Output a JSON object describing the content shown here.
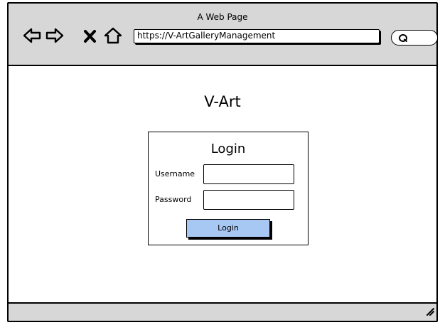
{
  "browser": {
    "page_title": "A Web Page",
    "url": "https://V-ArtGalleryManagement",
    "icons": [
      "back-arrow-icon",
      "forward-arrow-icon",
      "close-icon",
      "home-icon",
      "search-icon"
    ]
  },
  "main": {
    "site_title": "V-Art",
    "login": {
      "heading": "Login",
      "username_label": "Username",
      "password_label": "Password",
      "username_value": "",
      "password_value": "",
      "button_label": "Login"
    }
  },
  "colors": {
    "chrome": "#d7d7d7",
    "button": "#a8c8f4"
  }
}
